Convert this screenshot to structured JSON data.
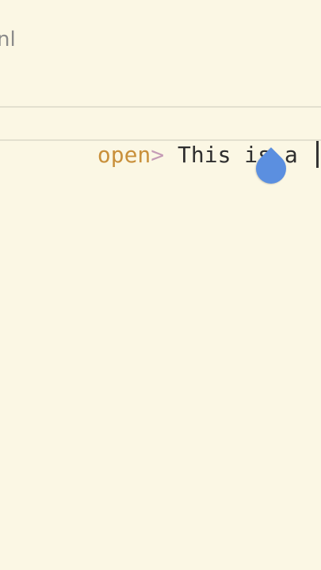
{
  "file_tab": {
    "title": "nl"
  },
  "editor": {
    "line": {
      "tag_name": "open",
      "bracket": ">",
      "text": " This is a "
    }
  }
}
